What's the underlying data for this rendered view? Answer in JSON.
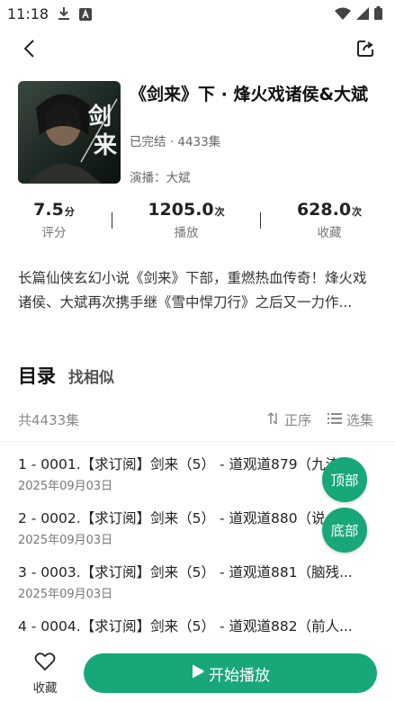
{
  "status_bar": {
    "time": "11:18",
    "icons": [
      "download-icon",
      "app-notification-icon",
      "wifi-icon",
      "signal-icon",
      "battery-icon"
    ]
  },
  "nav": {
    "back_icon": "chevron-left-icon",
    "share_icon": "share-icon"
  },
  "album": {
    "title": "《剑来》下 · 烽火戏诸侯&大斌",
    "status": "已完结 · 4433集",
    "cast": "演播：大斌",
    "cover_text": "剑来"
  },
  "stats": [
    {
      "value": "7.5",
      "unit": "分",
      "label": "评分"
    },
    {
      "value": "1205.0",
      "unit": "次",
      "label": "播放"
    },
    {
      "value": "628.0",
      "unit": "次",
      "label": "收藏"
    }
  ],
  "description": "长篇仙侠玄幻小说《剑来》下部，重燃热血传奇！烽火戏诸侯、大斌再次携手继《雪中悍刀行》之后又一力作...",
  "tabs": {
    "active": "目录",
    "inactive": "找相似"
  },
  "list_toolbar": {
    "count": "共4433集",
    "sort_label": "正序",
    "select_label": "选集"
  },
  "episodes": [
    {
      "title": "1 - 0001.【求订阅】剑来（5） - 道观道879（九流",
      "date": "2025年09月03日"
    },
    {
      "title": "2 - 0002.【求订阅】剑来（5） - 道观道880（说",
      "date": "2025年09月03日"
    },
    {
      "title": "3 - 0003.【求订阅】剑来（5） - 道观道881（脑残...",
      "date": "2025年09月03日"
    },
    {
      "title": "4 - 0004.【求订阅】剑来（5） - 道观道882（前人...",
      "date": ""
    }
  ],
  "float_buttons": {
    "top": "顶部",
    "bottom": "底部"
  },
  "bottom_bar": {
    "collect_label": "收藏",
    "play_label": "开始播放"
  },
  "colors": {
    "accent": "#18a779",
    "text_primary": "#222222",
    "text_secondary": "#777777"
  }
}
